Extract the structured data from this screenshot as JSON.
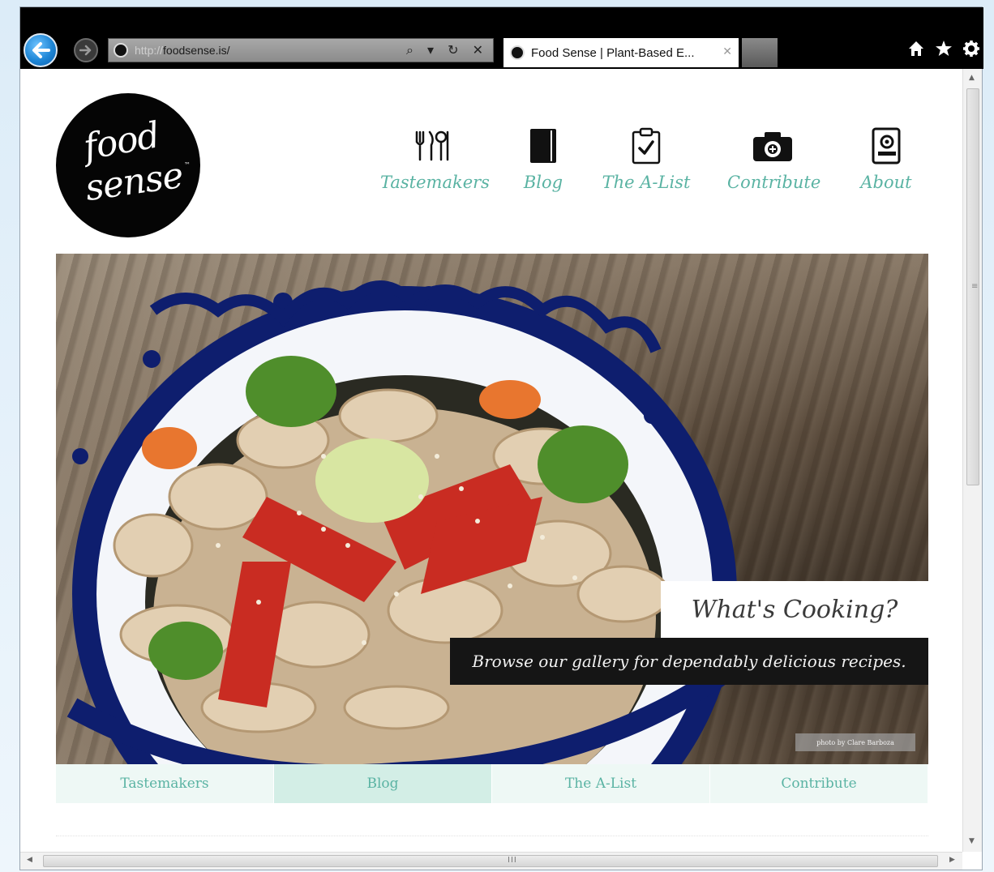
{
  "browser": {
    "url_prefix": "http://",
    "url_host": "foodsense.is/",
    "address_tools": "⌕ ▾ ↻ ✕",
    "tab_title": "Food Sense | Plant-Based E...",
    "tab_close": "✕"
  },
  "site": {
    "logo_line1": "food",
    "logo_line2": "sense",
    "logo_tm": "™"
  },
  "nav": {
    "items": [
      {
        "label": "Tastemakers",
        "icon": "utensils-icon"
      },
      {
        "label": "Blog",
        "icon": "book-icon"
      },
      {
        "label": "The A-List",
        "icon": "clipboard-check-icon"
      },
      {
        "label": "Contribute",
        "icon": "camera-icon"
      },
      {
        "label": "About",
        "icon": "contact-card-icon"
      }
    ]
  },
  "hero": {
    "title": "What's Cooking?",
    "subtitle": "Browse our gallery for dependably delicious recipes.",
    "credit": "photo by Clare Barboza"
  },
  "subnav": {
    "items": [
      {
        "label": "Tastemakers"
      },
      {
        "label": "Blog"
      },
      {
        "label": "The A-List"
      },
      {
        "label": "Contribute"
      }
    ],
    "active": "Blog"
  },
  "scrollbars": {
    "grip_h": "III",
    "grip_v": "≡"
  },
  "colors": {
    "accent": "#5ab3a3",
    "subnav_bg": "#eef8f5",
    "subnav_active": "#d3eee6",
    "chrome": "#000000"
  }
}
